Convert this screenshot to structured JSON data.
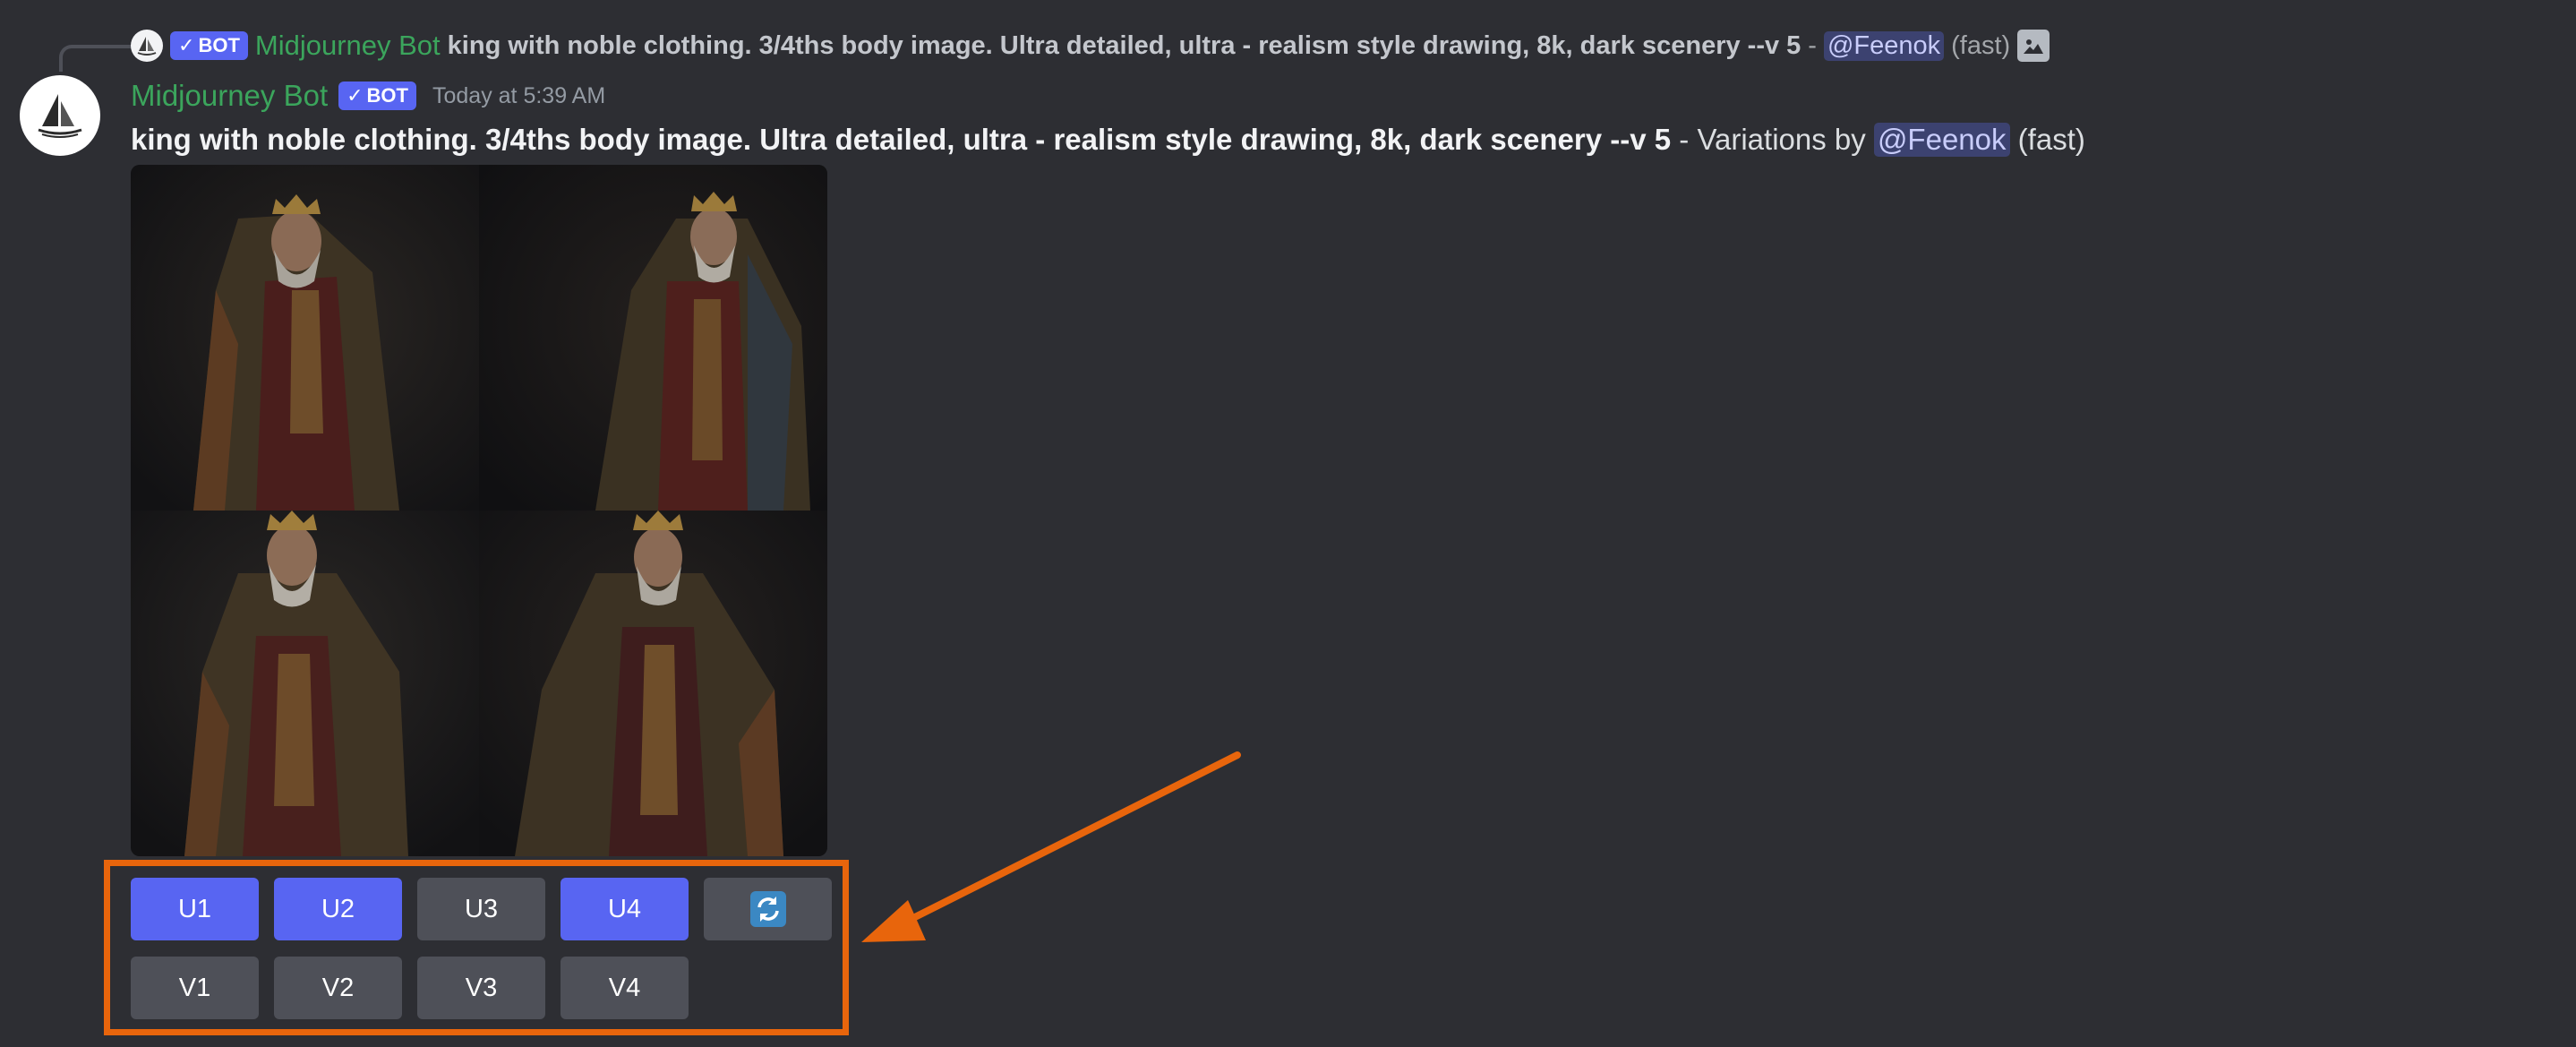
{
  "reply": {
    "bot_name": "Midjourney Bot",
    "bot_tag": "BOT",
    "prompt": "king with noble clothing. 3/4ths body image. Ultra detailed, ultra - realism style drawing, 8k, dark scenery --v 5",
    "separator": "-",
    "mention": "@Feenok",
    "speed": "(fast)",
    "attachment_icon": "image-icon"
  },
  "message": {
    "username": "Midjourney Bot",
    "bot_tag": "BOT",
    "timestamp": "Today at 5:39 AM",
    "prompt": "king with noble clothing. 3/4ths body image. Ultra detailed, ultra - realism style drawing, 8k, dark scenery --v 5",
    "suffix": " - Variations by ",
    "mention": "@Feenok",
    "speed": " (fast)",
    "avatar_icon": "sailboat-icon"
  },
  "buttons": {
    "row1": [
      {
        "label": "U1",
        "style": "primary"
      },
      {
        "label": "U2",
        "style": "primary"
      },
      {
        "label": "U3",
        "style": "secondary"
      },
      {
        "label": "U4",
        "style": "primary"
      },
      {
        "label": "",
        "style": "secondary",
        "icon": "reroll-icon"
      }
    ],
    "row2": [
      {
        "label": "V1",
        "style": "secondary"
      },
      {
        "label": "V2",
        "style": "secondary"
      },
      {
        "label": "V3",
        "style": "secondary"
      },
      {
        "label": "V4",
        "style": "secondary"
      }
    ]
  },
  "colors": {
    "background": "#2d2e33",
    "blurple": "#5865f2",
    "secondary_button": "#4e5058",
    "username_green": "#3ba55c",
    "annotation_orange": "#e8650c"
  }
}
